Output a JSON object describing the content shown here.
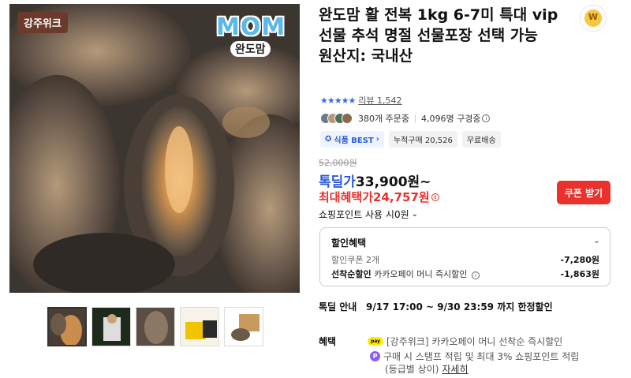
{
  "image": {
    "brand_badge": "강주위크",
    "logo_main": "MOM",
    "logo_sub": "완도맘"
  },
  "product": {
    "title": "완도맘 활 전복 1kg 6-7미 특대 vip선물 추석 명절 선물포장 선택 가능",
    "origin": "원산지: 국내산"
  },
  "rating": {
    "stars": "★★★★★",
    "review_label": "리뷰 1,542"
  },
  "buyers": {
    "orders": "380개 주문중",
    "subscribers": "4,096명 구경중"
  },
  "tags": {
    "best": "식품 BEST",
    "cumulative": "누적구매 20,526",
    "shipping": "무료배송"
  },
  "price": {
    "original": "52,000원",
    "deal_label": "톡딜가",
    "deal_value": "33,900원~",
    "max_benefit": "최대혜택가24,757원",
    "coupon_button": "쿠폰 받기",
    "point_use": "쇼핑포인트 사용 시0원"
  },
  "discount": {
    "header": "할인혜택",
    "coupon_label": "할인쿠폰 2개",
    "coupon_amount": "-7,280원",
    "firstcome_label": "선착순할인",
    "firstcome_desc": "카카오페이 머니 즉시할인",
    "firstcome_amount": "-1,863원"
  },
  "delivery": {
    "label": "톡딜 안내",
    "value": "9/17 17:00 ~ 9/30 23:59 까지 한정할인"
  },
  "benefit": {
    "label": "혜택",
    "pay_icon": "pay",
    "line1": "[강주위크] 카카오페이 머니 선착순 즉시할인",
    "line2": "구매 시 스탬프 적립 및 최대 3% 쇼핑포인트 적립",
    "line3": "(등급별 상이)",
    "more": "자세히"
  },
  "colors": {
    "accent_blue": "#2d5bd7",
    "accent_red": "#e8322b",
    "kakao_yellow": "#ffeb00"
  }
}
